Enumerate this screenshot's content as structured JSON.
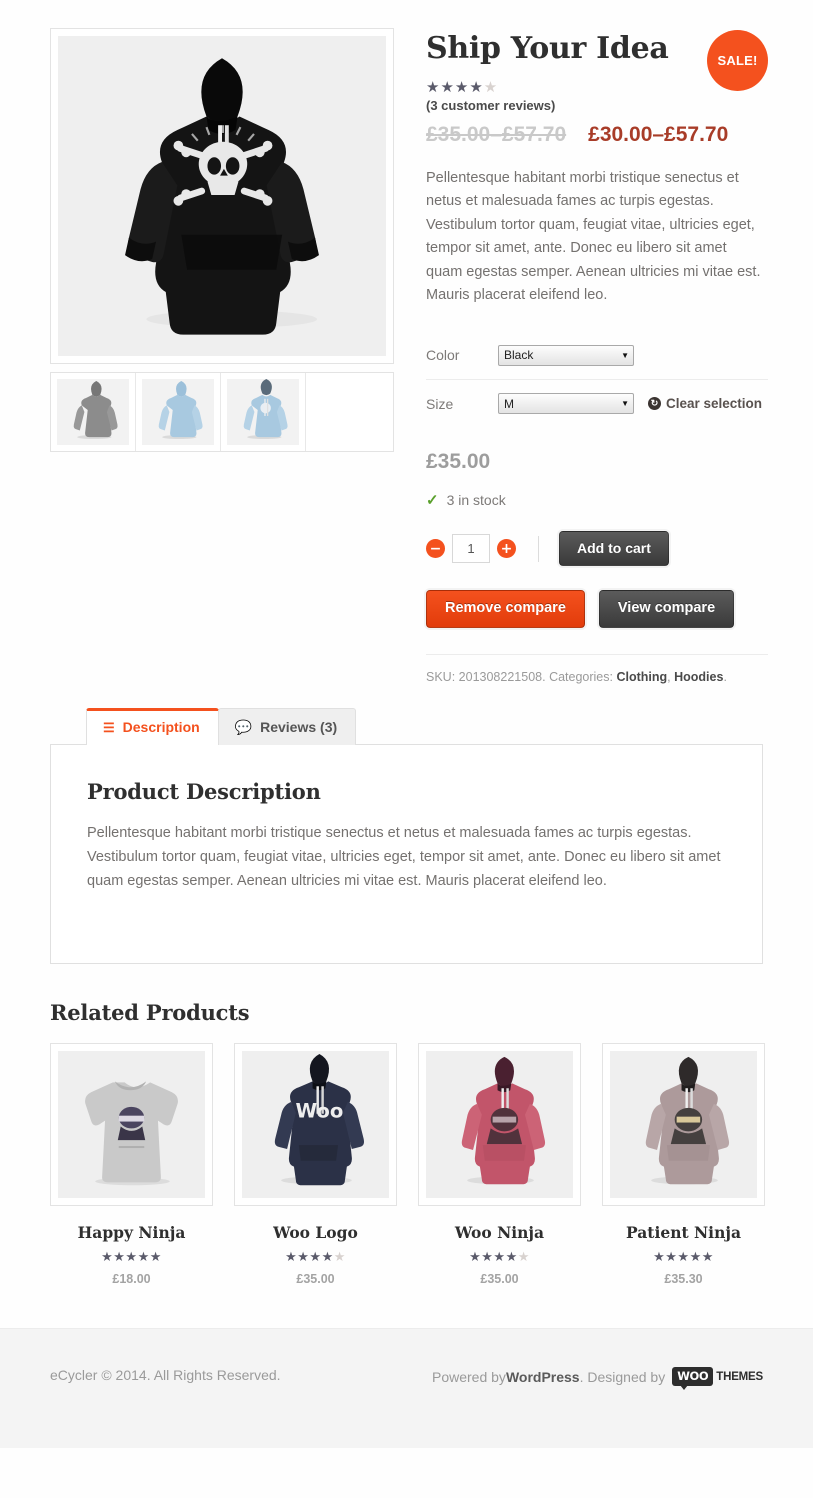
{
  "product": {
    "title": "Ship Your Idea",
    "sale_badge": "SALE!",
    "rating_value": 4,
    "review_count_label": "(3 customer reviews)",
    "price_old": "£35.00–£57.70",
    "price_new": "£30.00–£57.70",
    "short_description": "Pellentesque habitant morbi tristique senectus et netus et malesuada fames ac turpis egestas. Vestibulum tortor quam, feugiat vitae, ultricies eget, tempor sit amet, ante. Donec eu libero sit amet quam egestas semper. Aenean ultricies mi vitae est. Mauris placerat eleifend leo.",
    "variations": [
      {
        "label": "Color",
        "value": "Black",
        "options": [
          "Black"
        ]
      },
      {
        "label": "Size",
        "value": "M",
        "options": [
          "M"
        ]
      }
    ],
    "clear_selection_label": "Clear selection",
    "variation_price": "£35.00",
    "stock_status": "3 in stock",
    "quantity": "1",
    "add_to_cart_label": "Add to cart",
    "remove_compare_label": "Remove compare",
    "view_compare_label": "View compare",
    "meta": {
      "sku_prefix": "SKU:",
      "sku": "201308221508.",
      "categories_prefix": "Categories:",
      "categories": [
        "Clothing",
        "Hoodies"
      ]
    }
  },
  "tabs": [
    {
      "label": "Description",
      "icon": "list-icon",
      "active": true
    },
    {
      "label": "Reviews (3)",
      "icon": "comment-icon",
      "active": false
    }
  ],
  "description_panel": {
    "heading": "Product Description",
    "body": "Pellentesque habitant morbi tristique senectus et netus et malesuada fames ac turpis egestas. Vestibulum tortor quam, feugiat vitae, ultricies eget, tempor sit amet, ante. Donec eu libero sit amet quam egestas semper. Aenean ultricies mi vitae est. Mauris placerat eleifend leo."
  },
  "related": {
    "heading": "Related Products",
    "items": [
      {
        "title": "Happy Ninja",
        "rating": 5,
        "price": "£18.00"
      },
      {
        "title": "Woo Logo",
        "rating": 4,
        "price": "£35.00"
      },
      {
        "title": "Woo Ninja",
        "rating": 4.5,
        "price": "£35.00"
      },
      {
        "title": "Patient Ninja",
        "rating": 5,
        "price": "£35.30"
      }
    ]
  },
  "footer": {
    "copyright": "eCycler © 2014. All Rights Reserved.",
    "powered_prefix": "Powered by ",
    "powered_name": "WordPress",
    "designed_prefix": ". Designed by ",
    "woo_badge": "WOO",
    "woo_themes": "THEMES"
  },
  "colors": {
    "accent": "#f4511e",
    "sale_price": "#a83c28",
    "dark_button": "#3a3a3a",
    "stock_check": "#5aa02c"
  }
}
